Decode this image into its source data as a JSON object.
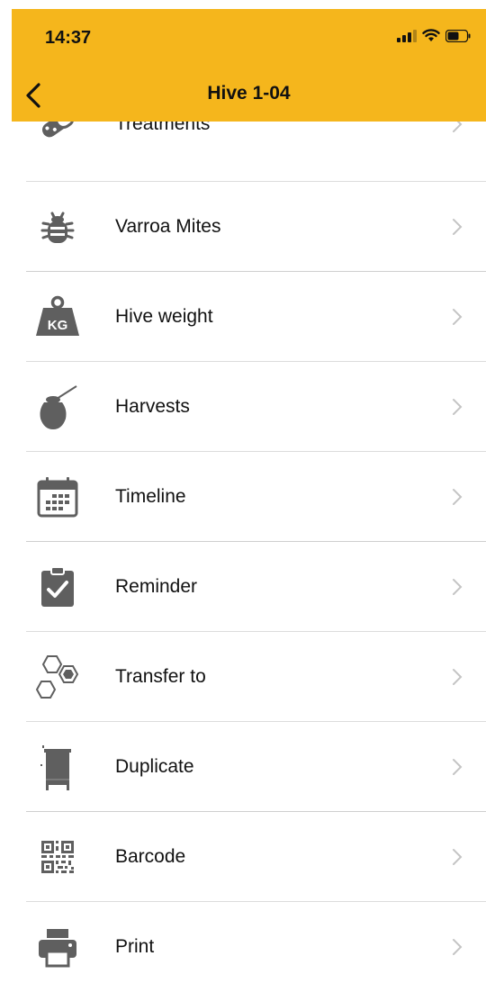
{
  "status_bar": {
    "time": "14:37"
  },
  "header": {
    "title": "Hive 1-04"
  },
  "colors": {
    "header_bg": "#f5b61c",
    "icon_gray": "#5f5f5f",
    "chevron": "#c4c4c4"
  },
  "menu": {
    "items": [
      {
        "label": "Treatments",
        "icon": "treatments-icon"
      },
      {
        "label": "Varroa Mites",
        "icon": "varroa-mite-icon"
      },
      {
        "label": "Hive weight",
        "icon": "weight-kg-icon"
      },
      {
        "label": "Harvests",
        "icon": "honey-pot-icon"
      },
      {
        "label": "Timeline",
        "icon": "calendar-icon"
      },
      {
        "label": "Reminder",
        "icon": "clipboard-check-icon"
      },
      {
        "label": "Transfer to",
        "icon": "hexagons-icon"
      },
      {
        "label": "Duplicate",
        "icon": "hive-box-icon"
      },
      {
        "label": "Barcode",
        "icon": "qr-code-icon"
      },
      {
        "label": "Print",
        "icon": "printer-icon"
      }
    ],
    "weight_icon_text": "KG"
  }
}
